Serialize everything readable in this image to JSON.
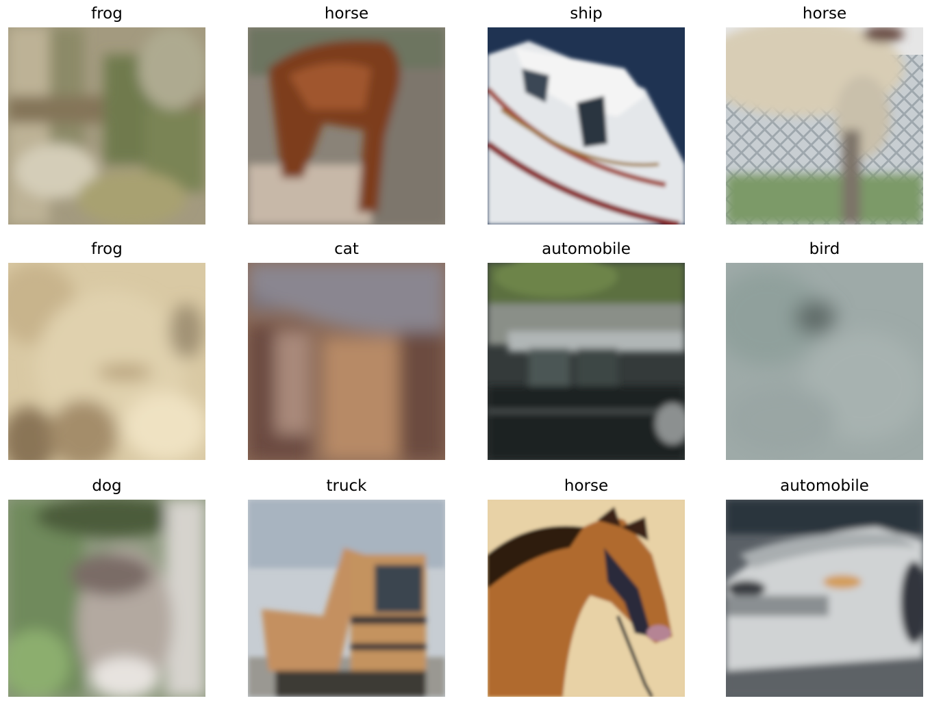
{
  "figure": {
    "images": [
      {
        "label": "frog"
      },
      {
        "label": "horse"
      },
      {
        "label": "ship"
      },
      {
        "label": "horse"
      },
      {
        "label": "frog"
      },
      {
        "label": "cat"
      },
      {
        "label": "automobile"
      },
      {
        "label": "bird"
      },
      {
        "label": "dog"
      },
      {
        "label": "truck"
      },
      {
        "label": "horse"
      },
      {
        "label": "automobile"
      }
    ]
  }
}
